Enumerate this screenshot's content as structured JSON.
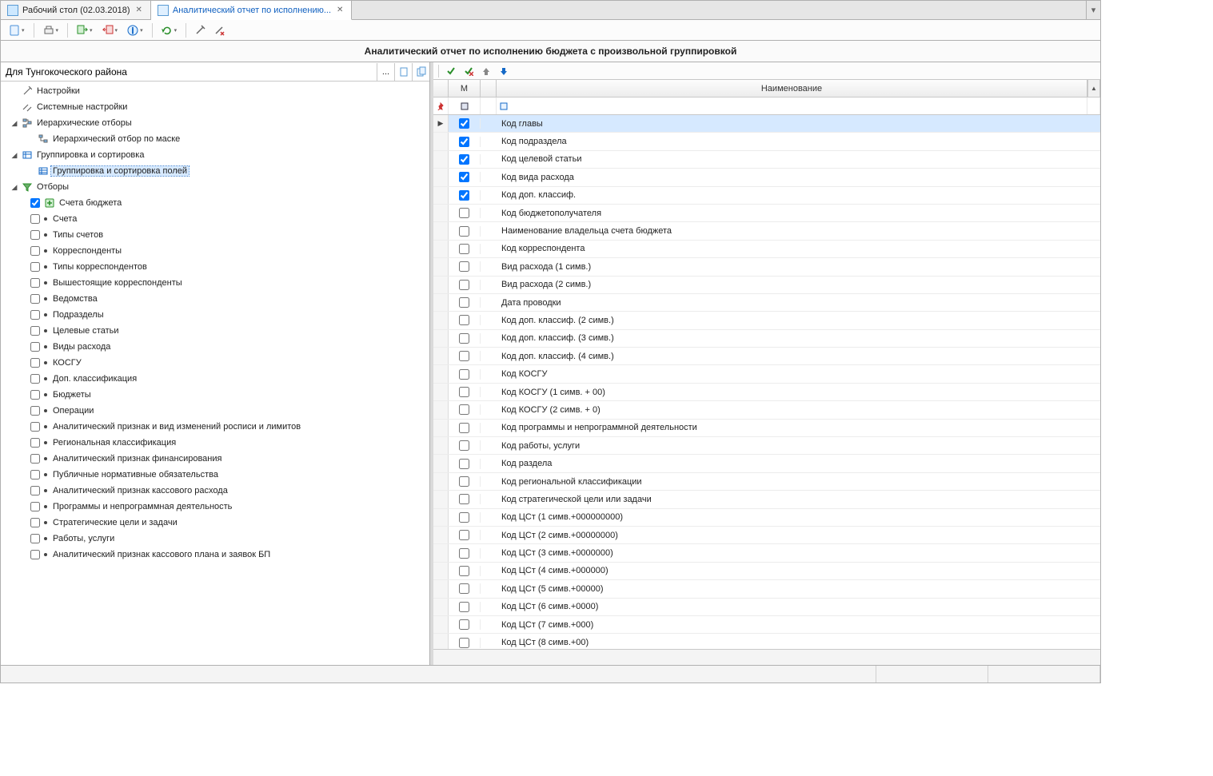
{
  "tabs": {
    "desktop": "Рабочий стол (02.03.2018)",
    "report": "Аналитический отчет по исполнению..."
  },
  "report_title": "Аналитический отчет по исполнению бюджета с произвольной группировкой",
  "template": {
    "value": "Для Тунгокоческого района",
    "more": "..."
  },
  "tree": {
    "settings": "Настройки",
    "sys_settings": "Системные настройки",
    "hier_sel": "Иерархические отборы",
    "hier_mask": "Иерархический отбор по маске",
    "group_sort": "Группировка и сортировка",
    "group_fields": "Группировка и сортировка полей",
    "filters": "Отборы",
    "filter_items": [
      {
        "label": "Счета бюджета",
        "checked": true,
        "plus": true
      },
      {
        "label": "Счета",
        "checked": false
      },
      {
        "label": "Типы счетов",
        "checked": false
      },
      {
        "label": "Корреспонденты",
        "checked": false
      },
      {
        "label": "Типы корреспондентов",
        "checked": false
      },
      {
        "label": "Вышестоящие корреспонденты",
        "checked": false
      },
      {
        "label": "Ведомства",
        "checked": false
      },
      {
        "label": "Подразделы",
        "checked": false
      },
      {
        "label": "Целевые статьи",
        "checked": false
      },
      {
        "label": "Виды расхода",
        "checked": false
      },
      {
        "label": "КОСГУ",
        "checked": false
      },
      {
        "label": "Доп. классификация",
        "checked": false
      },
      {
        "label": "Бюджеты",
        "checked": false
      },
      {
        "label": "Операции",
        "checked": false
      },
      {
        "label": "Аналитический признак и вид изменений росписи и лимитов",
        "checked": false
      },
      {
        "label": "Региональная классификация",
        "checked": false
      },
      {
        "label": "Аналитический признак финансирования",
        "checked": false
      },
      {
        "label": "Публичные нормативные обязательства",
        "checked": false
      },
      {
        "label": "Аналитический признак кассового расхода",
        "checked": false
      },
      {
        "label": "Программы и непрограммная деятельность",
        "checked": false
      },
      {
        "label": "Стратегические цели и задачи",
        "checked": false
      },
      {
        "label": "Работы, услуги",
        "checked": false
      },
      {
        "label": "Аналитический признак кассового плана и заявок БП",
        "checked": false
      }
    ]
  },
  "grid": {
    "column_m": "М",
    "column_name": "Наименование",
    "rows": [
      {
        "m": true,
        "name": "Код главы",
        "selected": true
      },
      {
        "m": true,
        "name": "Код подраздела"
      },
      {
        "m": true,
        "name": "Код целевой статьи"
      },
      {
        "m": true,
        "name": "Код вида расхода"
      },
      {
        "m": true,
        "name": "Код доп. классиф."
      },
      {
        "m": false,
        "name": "Код бюджетополучателя"
      },
      {
        "m": false,
        "name": "Наименование владельца счета бюджета"
      },
      {
        "m": false,
        "name": "Код корреспондента"
      },
      {
        "m": false,
        "name": "Вид расхода (1 симв.)"
      },
      {
        "m": false,
        "name": "Вид расхода (2 симв.)"
      },
      {
        "m": false,
        "name": "Дата проводки"
      },
      {
        "m": false,
        "name": "Код доп. классиф. (2 симв.)"
      },
      {
        "m": false,
        "name": "Код доп. классиф. (3 симв.)"
      },
      {
        "m": false,
        "name": "Код доп. классиф. (4 симв.)"
      },
      {
        "m": false,
        "name": "Код КОСГУ"
      },
      {
        "m": false,
        "name": "Код КОСГУ (1 симв. + 00)"
      },
      {
        "m": false,
        "name": "Код КОСГУ (2 симв. + 0)"
      },
      {
        "m": false,
        "name": "Код программы и непрограммной деятельности"
      },
      {
        "m": false,
        "name": "Код работы, услуги"
      },
      {
        "m": false,
        "name": "Код раздела"
      },
      {
        "m": false,
        "name": "Код региональной классификации"
      },
      {
        "m": false,
        "name": "Код стратегической цели или задачи"
      },
      {
        "m": false,
        "name": "Код ЦСт (1 симв.+000000000)"
      },
      {
        "m": false,
        "name": "Код ЦСт (2 симв.+00000000)"
      },
      {
        "m": false,
        "name": "Код ЦСт (3 симв.+0000000)"
      },
      {
        "m": false,
        "name": "Код ЦСт (4 симв.+000000)"
      },
      {
        "m": false,
        "name": "Код ЦСт (5 симв.+00000)"
      },
      {
        "m": false,
        "name": "Код ЦСт (6 симв.+0000)"
      },
      {
        "m": false,
        "name": "Код ЦСт (7 симв.+000)"
      },
      {
        "m": false,
        "name": "Код ЦСт (8 симв.+00)"
      }
    ]
  }
}
